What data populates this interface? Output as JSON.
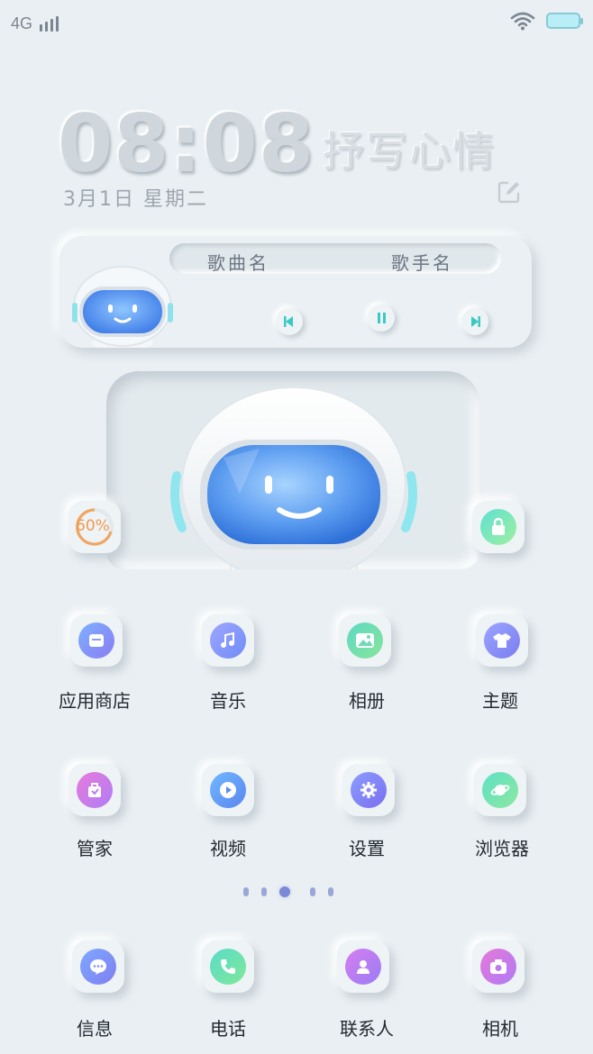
{
  "status_bar": {
    "network": "4G"
  },
  "clock": {
    "time": "08:08",
    "date": "3月1日  星期二"
  },
  "mood": {
    "text": "抒写心情",
    "edit_icon": "edit-icon"
  },
  "music": {
    "song": "歌曲名",
    "singer": "歌手名",
    "controls": [
      "prev-icon",
      "pause-icon",
      "next-icon"
    ]
  },
  "widgets": {
    "memory_percent": "60%",
    "lock_icon": "lock-icon"
  },
  "apps_row1": [
    {
      "label": "应用商店",
      "icon": "store-icon"
    },
    {
      "label": "音乐",
      "icon": "music-note-icon"
    },
    {
      "label": "相册",
      "icon": "gallery-icon"
    },
    {
      "label": "主题",
      "icon": "shirt-icon"
    }
  ],
  "apps_row2": [
    {
      "label": "管家",
      "icon": "manager-icon"
    },
    {
      "label": "视频",
      "icon": "play-icon"
    },
    {
      "label": "设置",
      "icon": "gear-icon"
    },
    {
      "label": "浏览器",
      "icon": "planet-icon"
    }
  ],
  "dock": [
    {
      "label": "信息",
      "icon": "message-icon"
    },
    {
      "label": "电话",
      "icon": "phone-icon"
    },
    {
      "label": "联系人",
      "icon": "person-icon"
    },
    {
      "label": "相机",
      "icon": "camera-icon"
    }
  ],
  "pager": {
    "pages": 5,
    "current": 3
  },
  "colors": {
    "background": "#e9eff2",
    "accent_blue": "#5a8cf0",
    "accent_teal": "#5ad6c8",
    "accent_purple": "#b266e6"
  }
}
